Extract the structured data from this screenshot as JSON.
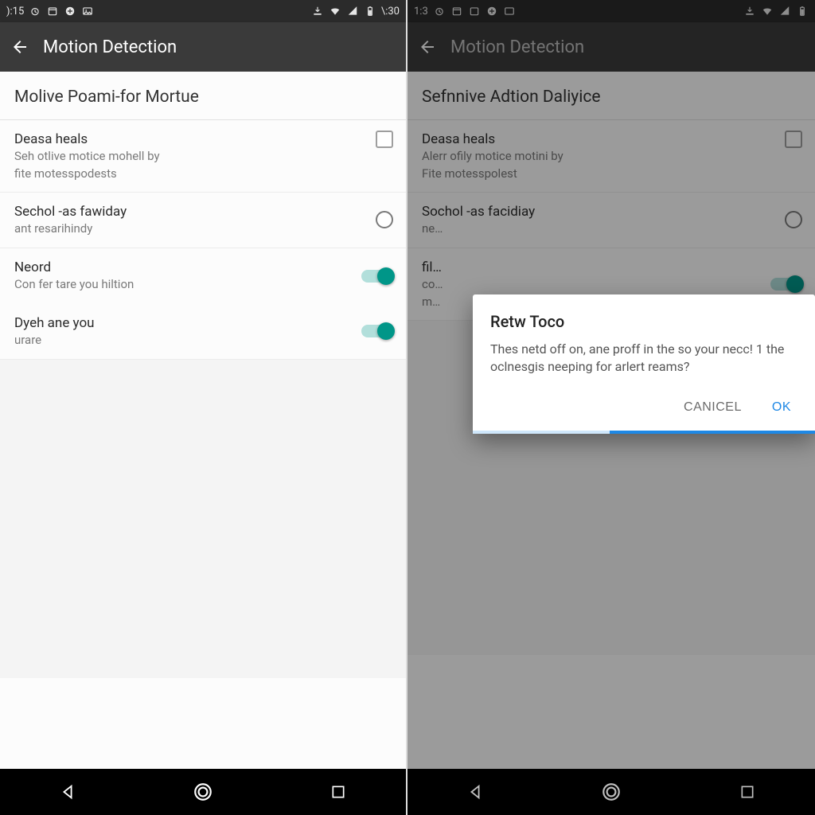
{
  "left": {
    "status": {
      "clock_left": "):15",
      "clock_right": "\\:30"
    },
    "appbar": {
      "title": "Motion Detection"
    },
    "section": "Molive Poami-for Mortue",
    "rows": {
      "r1": {
        "title": "Deasa heals",
        "sub1": "Seh otlive motice mohell by",
        "sub2": "fite motesspodests"
      },
      "r2": {
        "title": "Sechol -as fawiday",
        "sub1": "ant resarihindy"
      },
      "r3": {
        "title": "Neord",
        "sub1": "Con fer tare you hiltion"
      },
      "r4": {
        "title": "Dyeh ane you",
        "sub1": "urare"
      }
    }
  },
  "right": {
    "status": {
      "clock_left": "1:3"
    },
    "appbar": {
      "title": "Motion Detection"
    },
    "section": "Sefnnive Adtion Daliyice",
    "rows": {
      "r1": {
        "title": "Deasa heals",
        "sub1": "Alerr ofily motice motini by",
        "sub2": "Fite motesspolest"
      },
      "r2": {
        "title": "Sochol -as facidiay",
        "sub1": "ne…"
      },
      "r3": {
        "title": "fil…",
        "sub1": "co…",
        "sub2": "m…"
      }
    },
    "dialog": {
      "title": "Retw Toco",
      "body": "Thes netd off on, ane proff in the so your necc! 1 the oclnesgis neeping for arlert reams?",
      "cancel": "CANICEL",
      "ok": "OK"
    }
  }
}
